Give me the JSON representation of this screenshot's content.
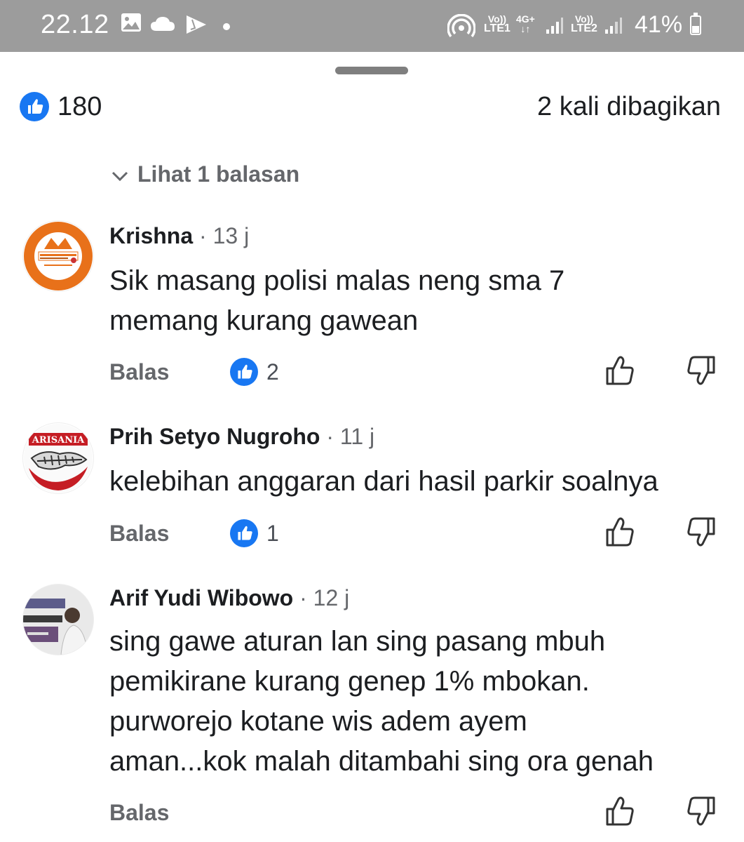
{
  "status_bar": {
    "time": "22.12",
    "sim1_top": "Vo))",
    "sim1_bottom": "LTE1",
    "network_top": "4G+",
    "network_bottom": "↓↑",
    "sim2_top": "Vo))",
    "sim2_bottom": "LTE2",
    "battery": "41%"
  },
  "post_stats": {
    "reaction_count": "180",
    "share_text": "2 kali dibagikan"
  },
  "view_replies_label": "Lihat 1 balasan",
  "comments": [
    {
      "name": "Krishna",
      "time": "· 13 j",
      "text_lines": [
        "Sik masang polisi malas neng sma 7",
        "memang kurang gawean"
      ],
      "reply_label": "Balas",
      "likes": "2"
    },
    {
      "name": "Prih Setyo Nugroho",
      "time": "· 11 j",
      "text_lines": [
        "kelebihan anggaran dari hasil parkir soalnya"
      ],
      "reply_label": "Balas",
      "likes": "1"
    },
    {
      "name": "Arif Yudi Wibowo",
      "time": "· 12 j",
      "text_lines": [
        "sing gawe aturan lan sing pasang mbuh",
        "pemikirane kurang genep 1% mbokan.",
        "purworejo kotane wis adem ayem",
        "aman...kok malah ditambahi sing ora genah"
      ],
      "reply_label": "Balas"
    }
  ],
  "colors": {
    "status_bar_bg": "#9c9c9c",
    "like_blue": "#1877f2",
    "secondary_text": "#65676b"
  },
  "icons": [
    "gallery-icon",
    "cloud-icon",
    "play-store-icon",
    "hotspot-icon",
    "signal-icon",
    "battery-icon",
    "like-icon",
    "chevron-down-icon",
    "thumb-up-icon",
    "thumb-down-icon"
  ]
}
